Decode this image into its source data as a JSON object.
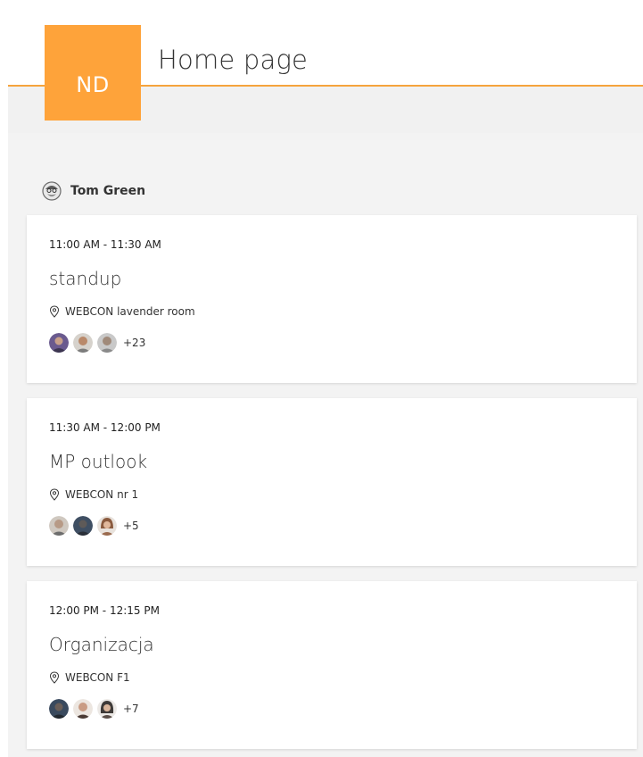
{
  "header": {
    "logo_text": "ND",
    "title": "Home page",
    "accent_color": "#fea33a"
  },
  "person": {
    "name": "Tom Green",
    "avatar_icon": "person-avatar-icon"
  },
  "meetings": [
    {
      "time": "11:00 AM - 11:30 AM",
      "title": "standup",
      "location": "WEBCON lavender room",
      "more_attendees": "+23",
      "attendee_colors": [
        "#6a5a8e",
        "#b9896a",
        "#a0a0a0"
      ]
    },
    {
      "time": "11:30 AM - 12:00 PM",
      "title": "MP outlook",
      "location": "WEBCON nr 1",
      "more_attendees": "+5",
      "attendee_colors": [
        "#b79a86",
        "#3f4f63",
        "#b5866c"
      ]
    },
    {
      "time": "12:00 PM - 12:15 PM",
      "title": "Organizacja",
      "location": "WEBCON F1",
      "more_attendees": "+7",
      "attendee_colors": [
        "#3a4a5e",
        "#c99c84",
        "#3e3a38"
      ]
    }
  ]
}
